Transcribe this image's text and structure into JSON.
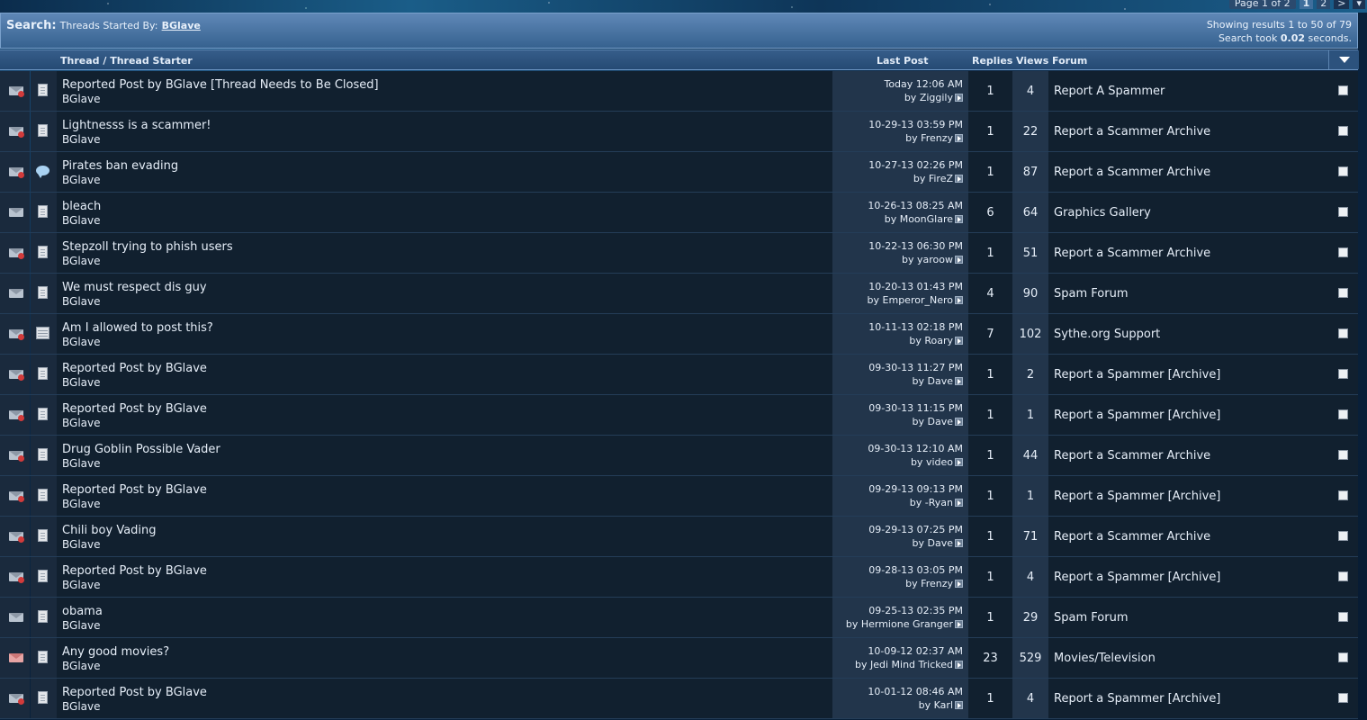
{
  "pagenav": {
    "label": "Page 1 of 2",
    "current": "1",
    "next_page": "2",
    "next_arrow": ">",
    "menu_arrow": "▾"
  },
  "search": {
    "label": "Search:",
    "subtitle": "Threads Started By:",
    "user": "BGlave",
    "results_line": "Showing results 1 to 50 of 79",
    "time_prefix": "Search took",
    "time_value": "0.02",
    "time_suffix": "seconds."
  },
  "columns": {
    "thread": "Thread / Thread Starter",
    "last_post": "Last Post",
    "replies": "Replies",
    "views": "Views",
    "forum": "Forum"
  },
  "threads": [
    {
      "title": "Reported Post by BGlave [Thread Needs to Be Closed]",
      "starter": "BGlave",
      "date": "Today 12:06 AM",
      "by": "by Ziggily",
      "replies": "1",
      "views": "4",
      "forum": "Report A Spammer",
      "status": "new",
      "type": "doc"
    },
    {
      "title": "Lightnesss is a scammer!",
      "starter": "BGlave",
      "date": "10-29-13 03:59 PM",
      "by": "by Frenzy",
      "replies": "1",
      "views": "22",
      "forum": "Report a Scammer Archive",
      "status": "new",
      "type": "doc"
    },
    {
      "title": "Pirates ban evading",
      "starter": "BGlave",
      "date": "10-27-13 02:26 PM",
      "by": "by FireZ",
      "replies": "1",
      "views": "87",
      "forum": "Report a Scammer Archive",
      "status": "new",
      "type": "bubble"
    },
    {
      "title": "bleach",
      "starter": "BGlave",
      "date": "10-26-13 08:25 AM",
      "by": "by MoonGlare",
      "replies": "6",
      "views": "64",
      "forum": "Graphics Gallery",
      "status": "read",
      "type": "doc"
    },
    {
      "title": "Stepzoll trying to phish users",
      "starter": "BGlave",
      "date": "10-22-13 06:30 PM",
      "by": "by yaroow",
      "replies": "1",
      "views": "51",
      "forum": "Report a Scammer Archive",
      "status": "new",
      "type": "doc"
    },
    {
      "title": "We must respect dis guy",
      "starter": "BGlave",
      "date": "10-20-13 01:43 PM",
      "by": "by Emperor_Nero",
      "replies": "4",
      "views": "90",
      "forum": "Spam Forum",
      "status": "read",
      "type": "doc"
    },
    {
      "title": "Am I allowed to post this?",
      "starter": "BGlave",
      "date": "10-11-13 02:18 PM",
      "by": "by Roary",
      "replies": "7",
      "views": "102",
      "forum": "Sythe.org Support",
      "status": "new",
      "type": "table"
    },
    {
      "title": "Reported Post by BGlave",
      "starter": "BGlave",
      "date": "09-30-13 11:27 PM",
      "by": "by Dave",
      "replies": "1",
      "views": "2",
      "forum": "Report a Spammer [Archive]",
      "status": "new",
      "type": "doc"
    },
    {
      "title": "Reported Post by BGlave",
      "starter": "BGlave",
      "date": "09-30-13 11:15 PM",
      "by": "by Dave",
      "replies": "1",
      "views": "1",
      "forum": "Report a Spammer [Archive]",
      "status": "new",
      "type": "doc"
    },
    {
      "title": "Drug Goblin Possible Vader",
      "starter": "BGlave",
      "date": "09-30-13 12:10 AM",
      "by": "by video",
      "replies": "1",
      "views": "44",
      "forum": "Report a Scammer Archive",
      "status": "new",
      "type": "doc"
    },
    {
      "title": "Reported Post by BGlave",
      "starter": "BGlave",
      "date": "09-29-13 09:13 PM",
      "by": "by -Ryan",
      "replies": "1",
      "views": "1",
      "forum": "Report a Spammer [Archive]",
      "status": "new",
      "type": "doc"
    },
    {
      "title": "Chili boy Vading",
      "starter": "BGlave",
      "date": "09-29-13 07:25 PM",
      "by": "by Dave",
      "replies": "1",
      "views": "71",
      "forum": "Report a Scammer Archive",
      "status": "new",
      "type": "doc"
    },
    {
      "title": "Reported Post by BGlave",
      "starter": "BGlave",
      "date": "09-28-13 03:05 PM",
      "by": "by Frenzy",
      "replies": "1",
      "views": "4",
      "forum": "Report a Spammer [Archive]",
      "status": "new",
      "type": "doc"
    },
    {
      "title": "obama",
      "starter": "BGlave",
      "date": "09-25-13 02:35 PM",
      "by": "by Hermione Granger",
      "replies": "1",
      "views": "29",
      "forum": "Spam Forum",
      "status": "read",
      "type": "doc"
    },
    {
      "title": "Any good movies?",
      "starter": "BGlave",
      "date": "10-09-12 02:37 AM",
      "by": "by Jedi Mind Tricked",
      "replies": "23",
      "views": "529",
      "forum": "Movies/Television",
      "status": "hot",
      "type": "doc"
    },
    {
      "title": "Reported Post by BGlave",
      "starter": "BGlave",
      "date": "10-01-12 08:46 AM",
      "by": "by Karl",
      "replies": "1",
      "views": "4",
      "forum": "Report a Spammer [Archive]",
      "status": "new",
      "type": "doc"
    }
  ]
}
